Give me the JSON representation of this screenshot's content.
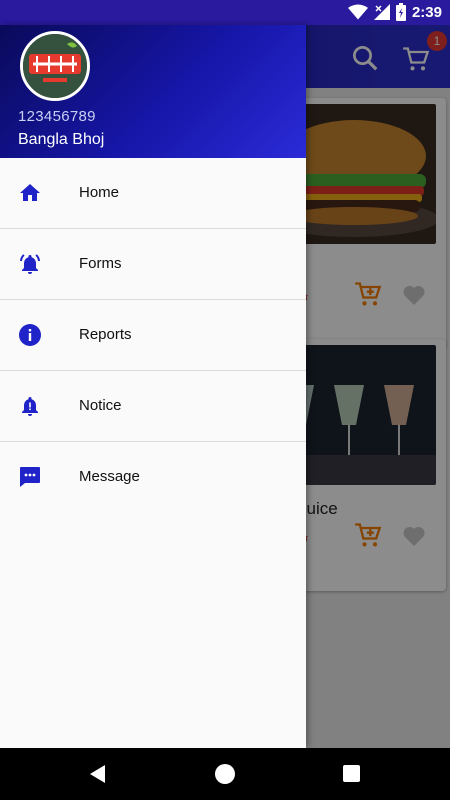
{
  "status_bar": {
    "time": "2:39"
  },
  "appbar": {
    "cart_count": "1"
  },
  "cards": [
    {
      "title": "",
      "price": "৳"
    },
    {
      "title": "Juice",
      "price": "৳"
    }
  ],
  "drawer": {
    "phone": "123456789",
    "name": "Bangla Bhoj",
    "items": [
      {
        "label": "Home",
        "icon": "home-icon"
      },
      {
        "label": "Forms",
        "icon": "alarm-bell-icon"
      },
      {
        "label": "Reports",
        "icon": "info-icon"
      },
      {
        "label": "Notice",
        "icon": "bell-icon"
      },
      {
        "label": "Message",
        "icon": "message-icon"
      }
    ]
  },
  "colors": {
    "accent": "#1f23c8",
    "orange": "#f57c00",
    "badge": "#e53935"
  }
}
